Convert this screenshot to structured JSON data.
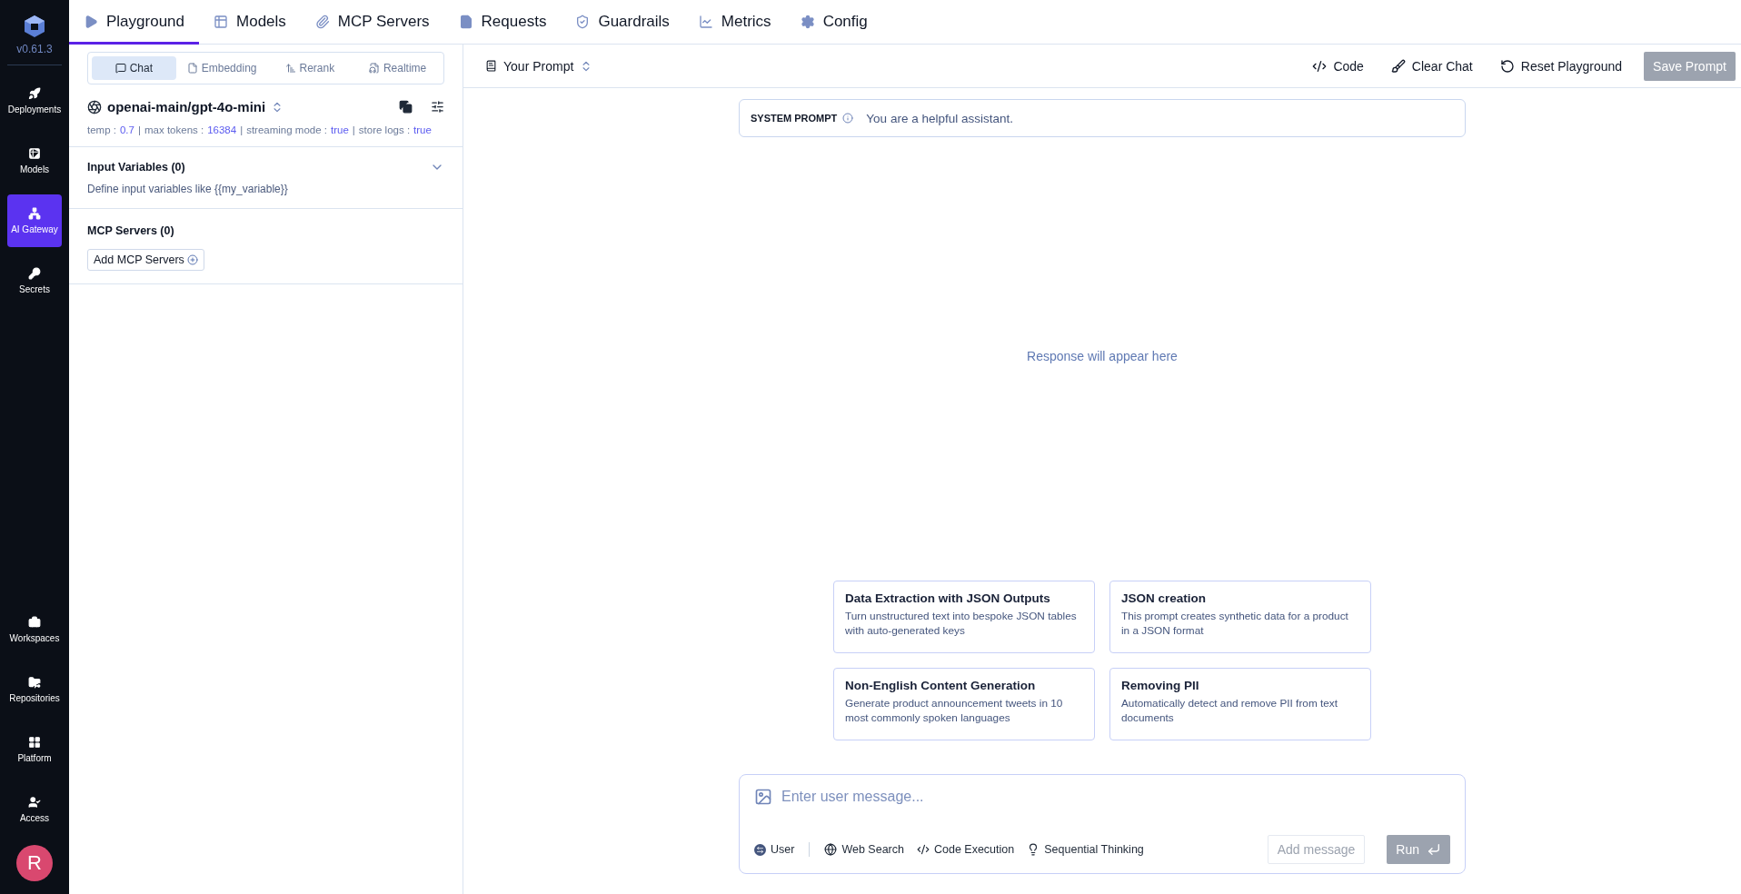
{
  "sidebar": {
    "version": "v0.61.3",
    "items": [
      {
        "label": "Deployments",
        "selected": false
      },
      {
        "label": "Models",
        "selected": false
      },
      {
        "label": "AI Gateway",
        "selected": true
      },
      {
        "label": "Secrets",
        "selected": false
      }
    ],
    "bottom_items": [
      {
        "label": "Workspaces",
        "selected": false
      },
      {
        "label": "Repositories",
        "selected": false
      },
      {
        "label": "Platform",
        "selected": false
      },
      {
        "label": "Access",
        "selected": false
      }
    ],
    "avatar": "R"
  },
  "top_tabs": [
    {
      "label": "Playground",
      "selected": true
    },
    {
      "label": "Models",
      "selected": false
    },
    {
      "label": "MCP Servers",
      "selected": false
    },
    {
      "label": "Requests",
      "selected": false
    },
    {
      "label": "Guardrails",
      "selected": false
    },
    {
      "label": "Metrics",
      "selected": false
    },
    {
      "label": "Config",
      "selected": false
    }
  ],
  "left_panel": {
    "mode_tabs": [
      {
        "label": "Chat",
        "selected": true
      },
      {
        "label": "Embedding",
        "selected": false
      },
      {
        "label": "Rerank",
        "selected": false
      },
      {
        "label": "Realtime",
        "selected": false
      }
    ],
    "model": "openai-main/gpt-4o-mini",
    "param_separator": "|",
    "params": [
      {
        "label": "temp :",
        "value": "0.7"
      },
      {
        "label": "max tokens :",
        "value": "16384"
      },
      {
        "label": "streaming mode :",
        "value": "true"
      },
      {
        "label": "store logs :",
        "value": "true"
      }
    ],
    "input_variables": {
      "title": "Input Variables (0)",
      "description": "Define input variables like {{my_variable}}",
      "expanded": false
    },
    "mcp_servers": {
      "title": "MCP Servers (0)",
      "button": "Add MCP Servers"
    }
  },
  "toolbar": {
    "prompt_name": "Your Prompt",
    "actions": [
      "Code",
      "Clear Chat",
      "Reset Playground"
    ],
    "save_button": {
      "label": "Save Prompt",
      "disabled": true
    }
  },
  "system_prompt": {
    "label": "SYSTEM PROMPT",
    "text": "You are a helpful assistant."
  },
  "response_placeholder": "Response will appear here",
  "suggestions": [
    {
      "title": "Data Extraction with JSON Outputs",
      "description": "Turn unstructured text into bespoke JSON tables with auto-generated keys"
    },
    {
      "title": "JSON creation",
      "description": "This prompt creates synthetic data for a product in a JSON format"
    },
    {
      "title": "Non-English Content Generation",
      "description": "Generate product announcement tweets in 10 most commonly spoken languages"
    },
    {
      "title": "Removing PII",
      "description": "Automatically detect and remove PII from text documents"
    }
  ],
  "composer": {
    "placeholder": "Enter user message...",
    "role": "User",
    "tools": [
      "Web Search",
      "Code Execution",
      "Sequential Thinking"
    ],
    "add_button": {
      "label": "Add message",
      "disabled": true
    },
    "run_button": {
      "label": "Run",
      "disabled": true
    }
  }
}
